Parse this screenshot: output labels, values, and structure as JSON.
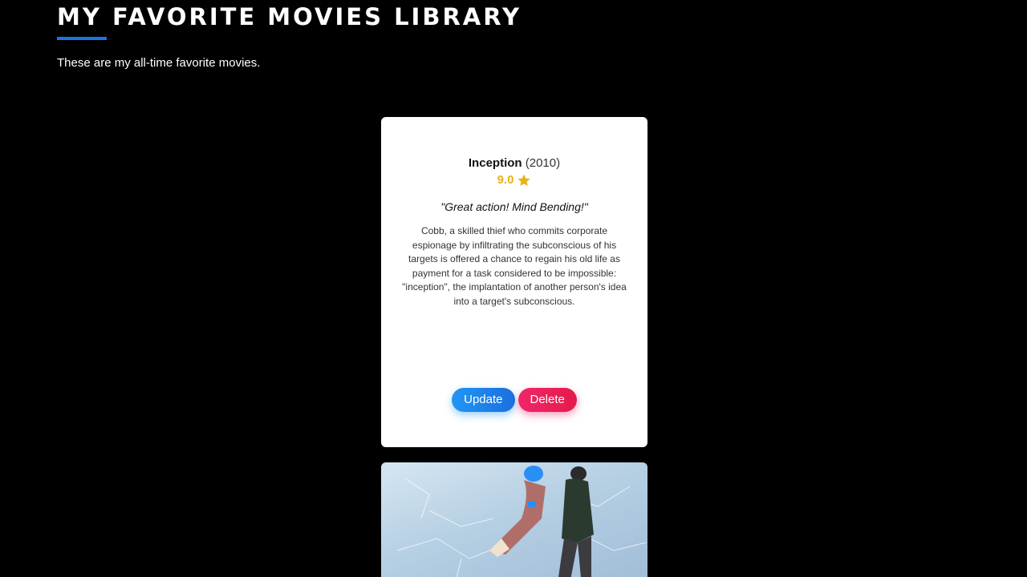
{
  "page": {
    "title": "MY FAVORITE MOVIES LIBRARY",
    "subtitle": "These are my all-time favorite movies.",
    "accent_color": "#1a73e8"
  },
  "movies": [
    {
      "name": "Inception",
      "year": "(2010)",
      "rating": "9.0",
      "rating_icon": "star-icon",
      "quote": "\"Great action! Mind Bending!\"",
      "description": "Cobb, a skilled thief who commits corporate espionage by infiltrating the subconscious of his targets is offered a chance to regain his old life as payment for a task considered to be impossible: \"inception\", the implantation of another person's idea into a target's subconscious.",
      "update_label": "Update",
      "delete_label": "Delete"
    }
  ],
  "colors": {
    "rating": "#e8b21f",
    "update_button": "#1a6fe0",
    "delete_button": "#e51a4c"
  }
}
